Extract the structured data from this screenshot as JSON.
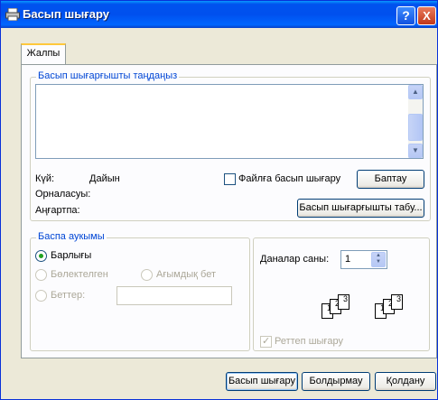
{
  "window": {
    "title": "Басып шығару"
  },
  "titlebar": {
    "help": "?",
    "close": "X"
  },
  "tabs": [
    {
      "label": "Жалпы"
    }
  ],
  "printer_group": {
    "legend": "Басып шығарғышты таңдаңыз",
    "status_label": "Күй:",
    "status_value": "Дайын",
    "location_label": "Орналасуы:",
    "comment_label": "Аңғартпа:",
    "print_to_file": "Файлға басып шығару",
    "print_to_file_checked": false,
    "preferences_button": "Баптау",
    "find_printer_button": "Басып шығарғышты табу..."
  },
  "page_range": {
    "legend": "Баспа аукымы",
    "all": "Барлығы",
    "selection": "Бөлектелген",
    "current_page": "Ағымдық бет",
    "pages": "Беттер:",
    "pages_value": "",
    "selected": "all"
  },
  "copies": {
    "label": "Даналар саны:",
    "value": "1",
    "collate": "Реттеп шығару",
    "collate_checked": true,
    "collate_icon_pages": [
      "1",
      "2",
      "3"
    ]
  },
  "buttons": {
    "print": "Басып шығару",
    "cancel": "Болдырмау",
    "apply": "Қолдану"
  }
}
